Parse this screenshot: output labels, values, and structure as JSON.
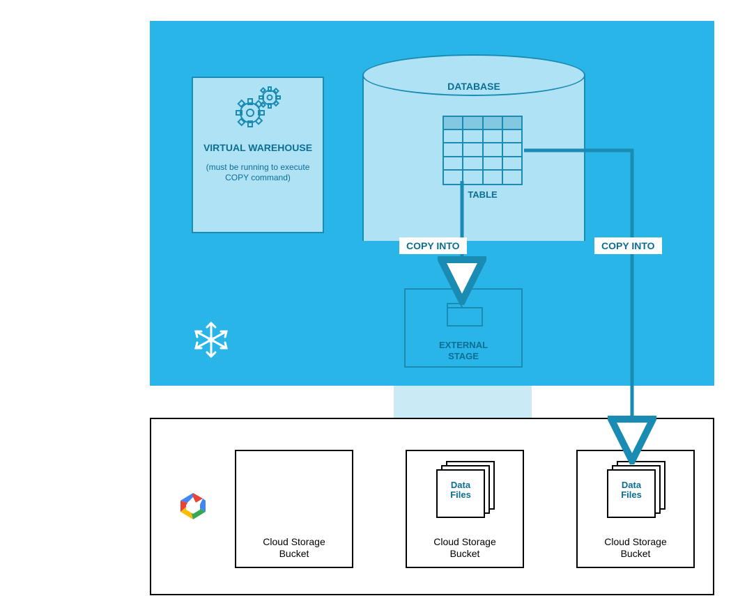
{
  "snowflake": {
    "warehouse": {
      "title": "VIRTUAL WAREHOUSE",
      "note": "(must be running to execute COPY command)"
    },
    "database": {
      "label": "DATABASE",
      "table_label": "TABLE"
    },
    "external_stage": {
      "label_line1": "EXTERNAL",
      "label_line2": "STAGE"
    },
    "copy_into_left": "COPY INTO",
    "copy_into_right": "COPY INTO"
  },
  "cloud": {
    "bucket1_label_l1": "Cloud Storage",
    "bucket1_label_l2": "Bucket",
    "bucket2_label_l1": "Cloud Storage",
    "bucket2_label_l2": "Bucket",
    "bucket3_label_l1": "Cloud Storage",
    "bucket3_label_l2": "Bucket",
    "datafiles_l1": "Data",
    "datafiles_l2": "Files"
  },
  "icons": {
    "gears": "gears-icon",
    "snowflake": "snowflake-icon",
    "folder": "folder-icon",
    "gcp": "google-cloud-icon"
  },
  "colors": {
    "snowflake_bg": "#29b5e8",
    "light": "#b0e2f5",
    "stroke": "#1a8bb3",
    "text": "#0b6e94"
  }
}
